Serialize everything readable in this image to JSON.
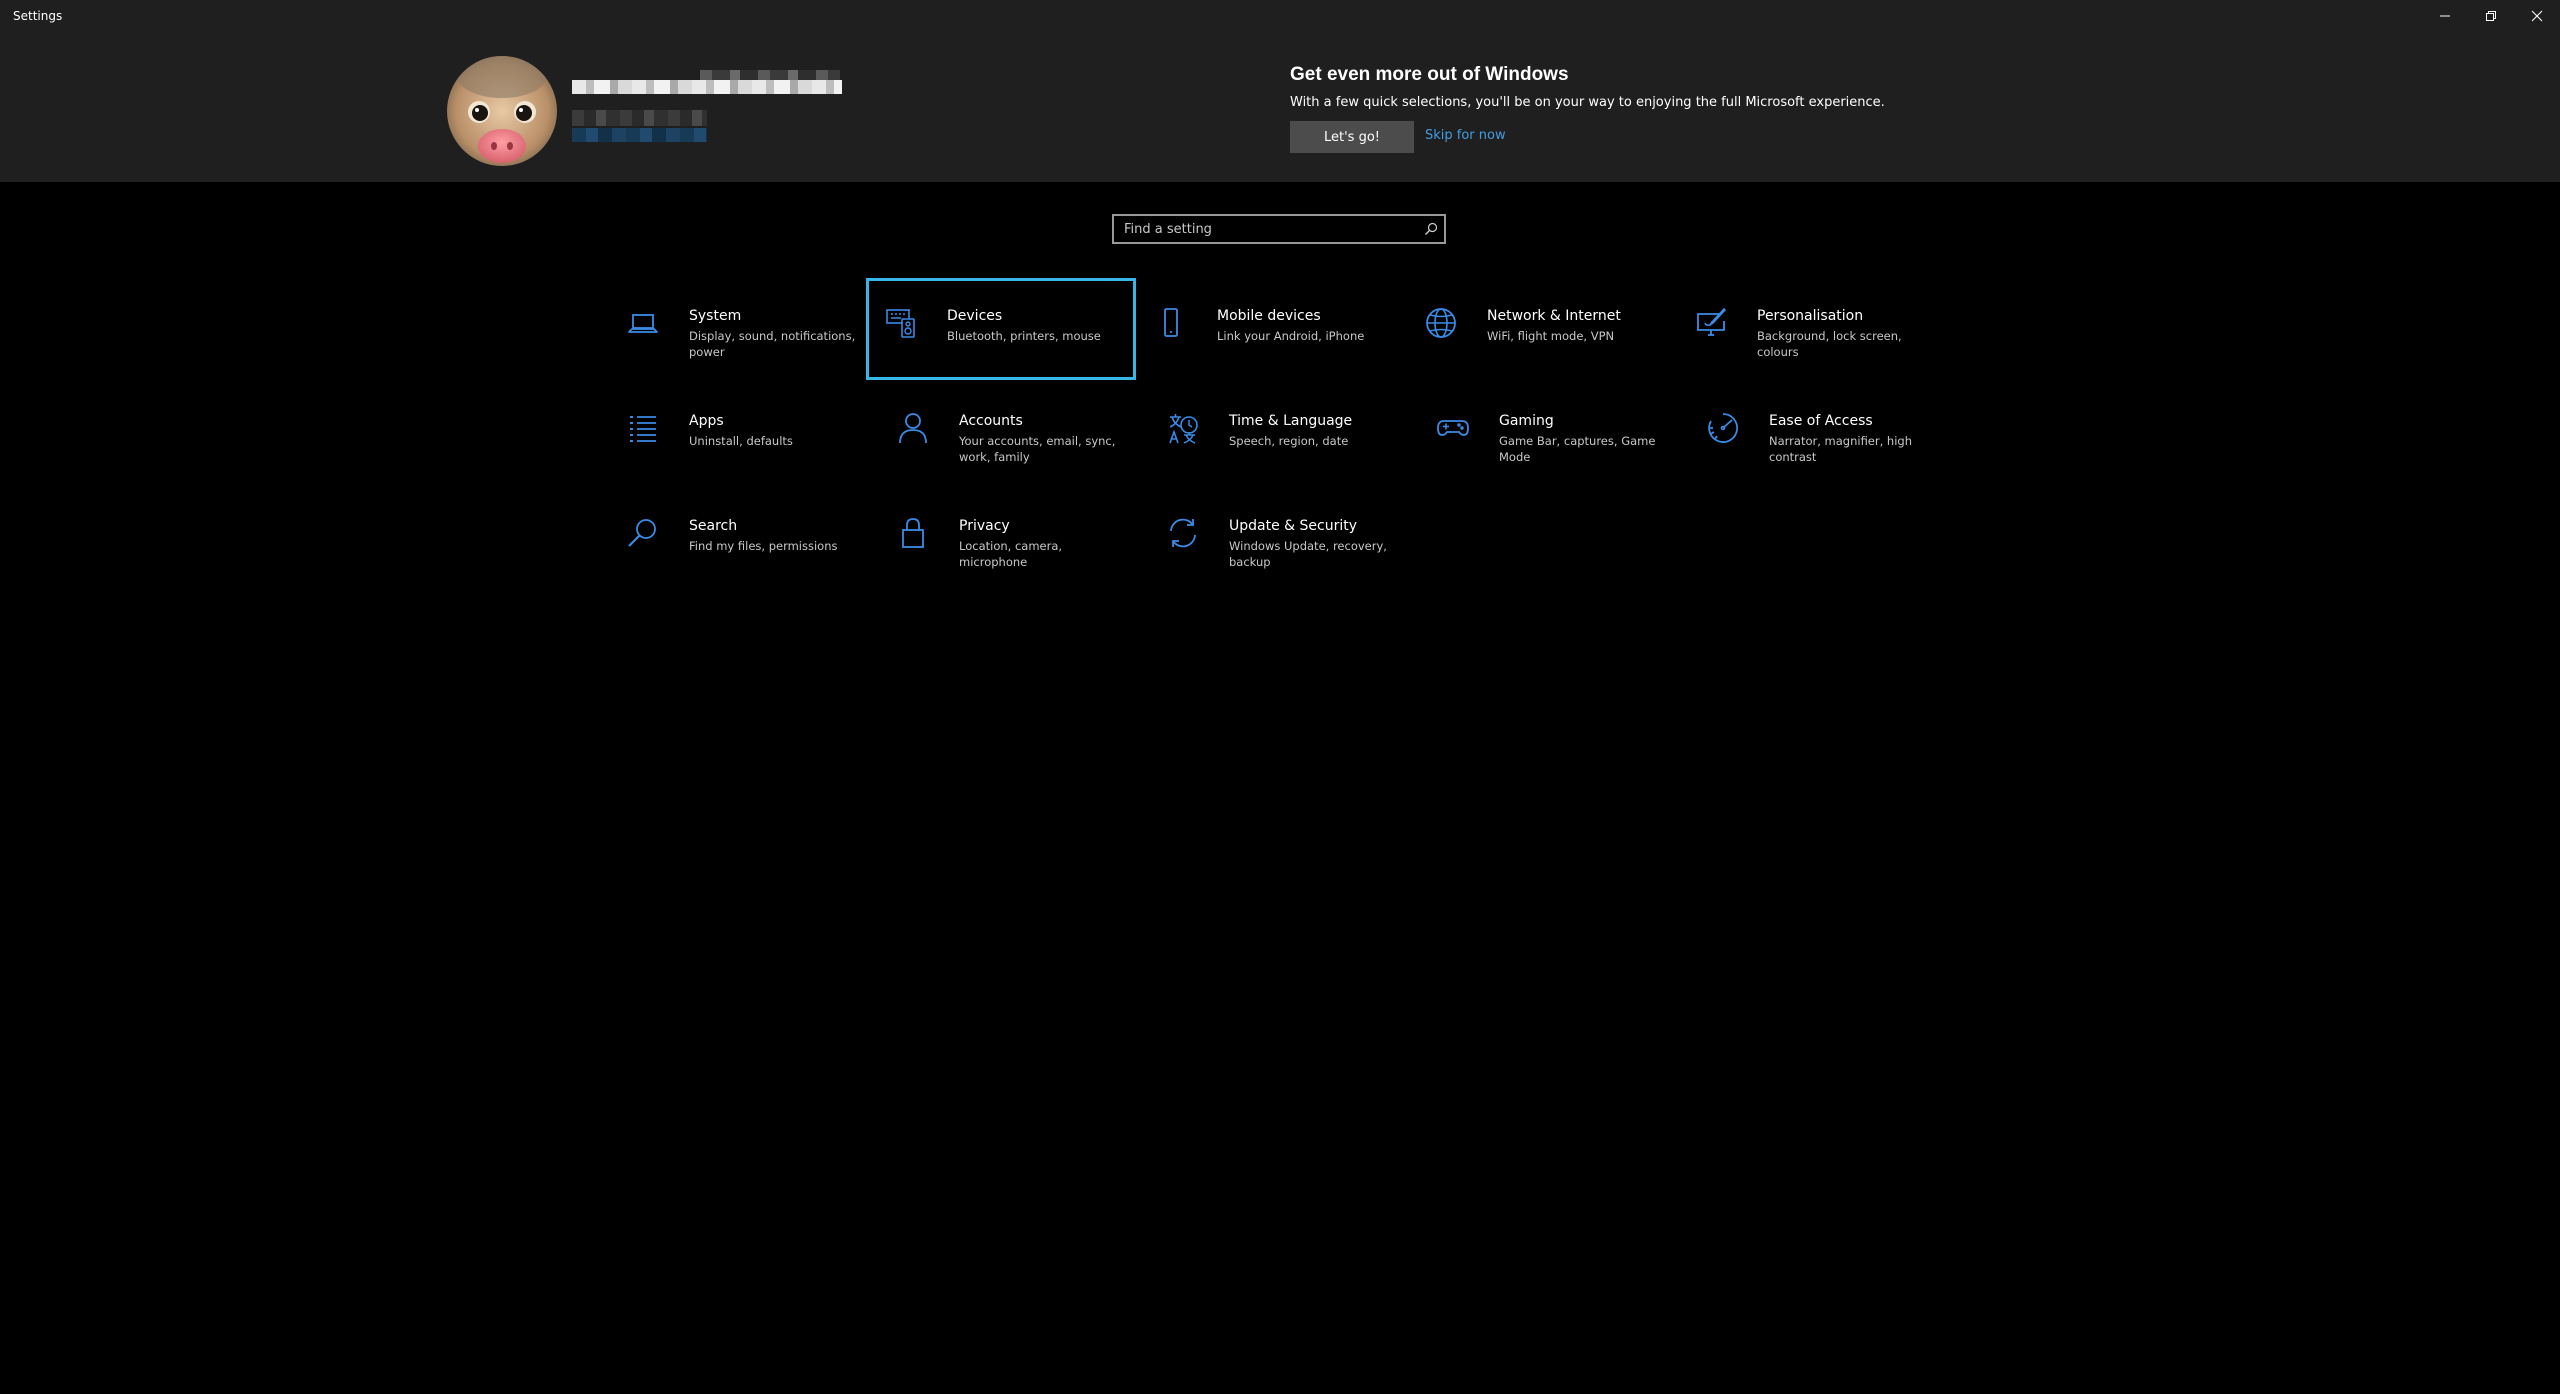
{
  "window": {
    "title": "Settings"
  },
  "promo": {
    "title": "Get even more out of Windows",
    "description": "With a few quick selections, you'll be on your way to enjoying the full Microsoft experience.",
    "primary_button": "Let's go!",
    "secondary_link": "Skip for now"
  },
  "search": {
    "placeholder": "Find a setting"
  },
  "categories": [
    {
      "label": "System",
      "description": "Display, sound, notifications, power",
      "icon": "laptop-icon"
    },
    {
      "label": "Devices",
      "description": "Bluetooth, printers, mouse",
      "icon": "devices-icon",
      "selected": true
    },
    {
      "label": "Mobile devices",
      "description": "Link your Android, iPhone",
      "icon": "phone-icon"
    },
    {
      "label": "Network & Internet",
      "description": "WiFi, flight mode, VPN",
      "icon": "globe-icon"
    },
    {
      "label": "Personalisation",
      "description": "Background, lock screen, colours",
      "icon": "personalisation-icon"
    },
    {
      "label": "Apps",
      "description": "Uninstall, defaults",
      "icon": "apps-list-icon"
    },
    {
      "label": "Accounts",
      "description": "Your accounts, email, sync, work, family",
      "icon": "person-icon"
    },
    {
      "label": "Time & Language",
      "description": "Speech, region, date",
      "icon": "time-language-icon"
    },
    {
      "label": "Gaming",
      "description": "Game Bar, captures, Game Mode",
      "icon": "gamepad-icon"
    },
    {
      "label": "Ease of Access",
      "description": "Narrator, magnifier, high contrast",
      "icon": "ease-of-access-icon"
    },
    {
      "label": "Search",
      "description": "Find my files, permissions",
      "icon": "search-icon"
    },
    {
      "label": "Privacy",
      "description": "Location, camera, microphone",
      "icon": "lock-icon"
    },
    {
      "label": "Update & Security",
      "description": "Windows Update, recovery, backup",
      "icon": "sync-icon"
    }
  ],
  "colors": {
    "accent": "#3a8be6",
    "selection_border": "#38b6e8",
    "link": "#429ce3",
    "chrome": "#1f1f1f",
    "background": "#000000"
  }
}
